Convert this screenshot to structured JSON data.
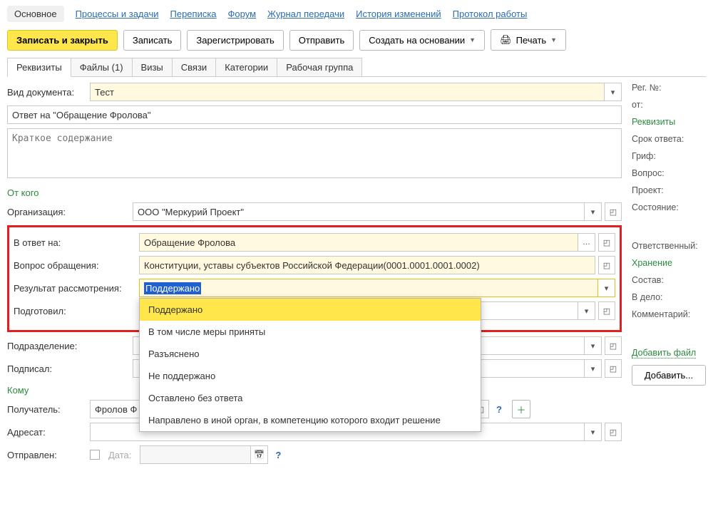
{
  "nav": {
    "main": "Основное",
    "processes": "Процессы и задачи",
    "correspondence": "Переписка",
    "forum": "Форум",
    "transfer_log": "Журнал передачи",
    "history": "История изменений",
    "protocol": "Протокол работы"
  },
  "toolbar": {
    "save_close": "Записать и закрыть",
    "save": "Записать",
    "register": "Зарегистрировать",
    "send": "Отправить",
    "create_based": "Создать на основании",
    "print": "Печать"
  },
  "tabs": {
    "details": "Реквизиты",
    "files": "Файлы (1)",
    "visas": "Визы",
    "links": "Связи",
    "categories": "Категории",
    "workgroup": "Рабочая группа"
  },
  "form": {
    "doc_type_label": "Вид документа:",
    "doc_type_value": "Тест",
    "title_value": "Ответ на \"Обращение Фролова\"",
    "summary_placeholder": "Краткое содержание",
    "from_section": "От кого",
    "org_label": "Организация:",
    "org_value": "ООО \"Меркурий Проект\"",
    "reply_to_label": "В ответ на:",
    "reply_to_value": "Обращение Фролова",
    "question_label": "Вопрос обращения:",
    "question_value": "Конституции, уставы субъектов Российской Федерации(0001.0001.0001.0002)",
    "result_label": "Результат рассмотрения:",
    "result_value": "Поддержано",
    "prepared_label": "Подготовил:",
    "department_label": "Подразделение:",
    "signed_label": "Подписал:",
    "to_section": "Кому",
    "recipient_label": "Получатель:",
    "recipient_value": "Фролов Ф",
    "addressee_label": "Адресат:",
    "sent_label": "Отправлен:",
    "date_label": "Дата:"
  },
  "dropdown": {
    "opt1": "Поддержано",
    "opt2": "В том числе меры приняты",
    "opt3": "Разъяснено",
    "opt4": "Не поддержано",
    "opt5": "Оставлено без ответа",
    "opt6": "Направлено в иной орган, в компетенцию которого входит решение"
  },
  "side": {
    "reg_no": "Рег. №:",
    "from": "от:",
    "details": "Реквизиты",
    "reply_due": "Срок ответа:",
    "grif": "Гриф:",
    "question": "Вопрос:",
    "project": "Проект:",
    "state": "Состояние:",
    "responsible": "Ответственный:",
    "storage": "Хранение",
    "composition": "Состав:",
    "to_case": "В дело:",
    "comment": "Комментарий:",
    "add_file": "Добавить файл",
    "add_btn": "Добавить..."
  }
}
